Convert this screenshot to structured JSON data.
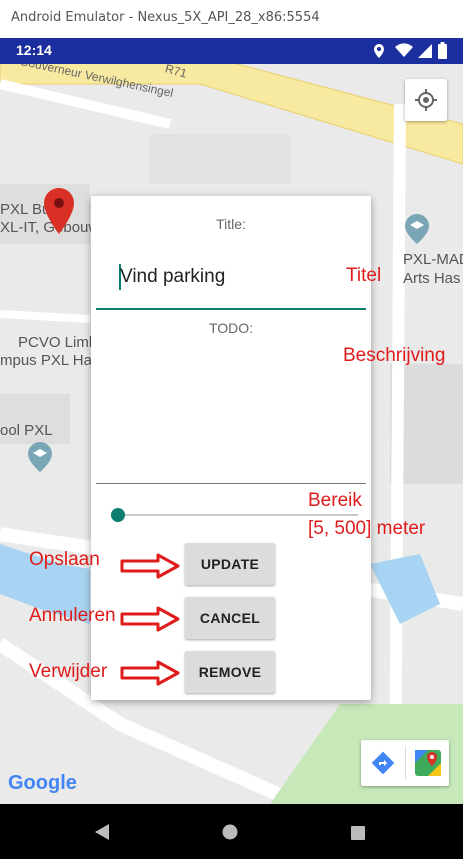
{
  "window": {
    "title": "Android Emulator - Nexus_5X_API_28_x86:5554"
  },
  "status_bar": {
    "time": "12:14"
  },
  "map": {
    "road_label_1": "Gouverneur Verwilghensingel",
    "road_label_2": "R71",
    "place_1_line1": "PXL Bu",
    "place_1_line2": "XL-IT, Gebouw",
    "place_2_line1": "PXL-MAD",
    "place_2_line2": "Arts Has",
    "place_3_line1": "PCVO Limb",
    "place_3_line2": "mpus PXL Has",
    "place_4": "ool PXL",
    "google_logo": "Google"
  },
  "dialog": {
    "title_label": "Title:",
    "title_value": "Vind parking",
    "todo_label": "TODO:",
    "slider_value_fraction": 0.02,
    "buttons": {
      "update": "UPDATE",
      "cancel": "CANCEL",
      "remove": "REMOVE"
    }
  },
  "annotations": {
    "titel": "Titel",
    "beschrijving": "Beschrijving",
    "bereik_line1": "Bereik",
    "bereik_line2": "[5, 500] meter",
    "opslaan": "Opslaan",
    "annuleren": "Annuleren",
    "verwijder": "Verwijder",
    "color": "#e01b1b"
  },
  "colors": {
    "status_bar": "#1a2e9e",
    "accent": "#0d7d6d",
    "marker": "#d93025"
  }
}
